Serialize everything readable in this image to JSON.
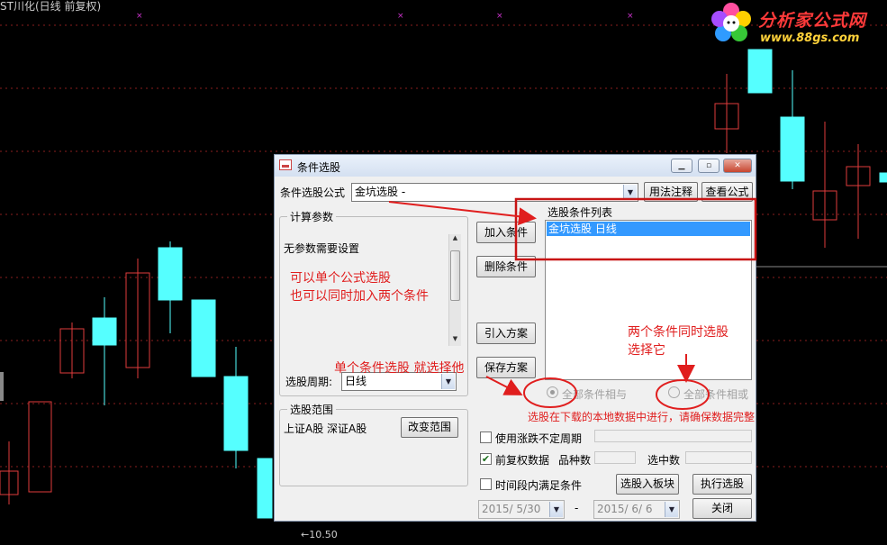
{
  "chart": {
    "stock_title": "ST川化(日线 前复权)",
    "price_marker": "←10.50"
  },
  "logo": {
    "name": "分析家公式网",
    "url": "www.88gs.com",
    "icon": "flower-logo-icon"
  },
  "dialog": {
    "title": "条件选股",
    "formula_label": "条件选股公式",
    "formula_value": "金坑选股        -",
    "usage_button": "用法注释",
    "view_formula_button": "查看公式",
    "params_group_title": "计算参数",
    "params_text": "无参数需要设置",
    "add_condition_button": "加入条件",
    "delete_condition_button": "删除条件",
    "import_plan_button": "引入方案",
    "save_plan_button": "保存方案",
    "condition_list_title": "选股条件列表",
    "condition_list_items": [
      "金坑选股   日线"
    ],
    "period_label": "选股周期:",
    "period_value": "日线",
    "all_and_label": "全部条件相与",
    "all_or_label": "全部条件相或",
    "scope_group_title": "选股范围",
    "scope_text": "上证A股 深证A股",
    "change_scope_button": "改变范围",
    "use_variable_period_label": "使用涨跌不定周期",
    "forward_adjust_label": "前复权数据",
    "forward_adjust_checked": true,
    "variety_count_label": "品种数",
    "selected_count_label": "选中数",
    "time_range_label": "时间段内满足条件",
    "add_to_block_button": "选股入板块",
    "execute_button": "执行选股",
    "close_button": "关闭",
    "date_from": "2015/ 5/30",
    "date_sep": "-",
    "date_to": "2015/ 6/ 6"
  },
  "annotations": {
    "note_single_formula": "可以单个公式选股",
    "note_two_conditions": "也可以同时加入两个条件",
    "note_two_select": "两个条件同时选股",
    "note_choose_it": "选择它",
    "note_single_select": "单个条件选股 就选择他",
    "note_download": "选股在下载的本地数据中进行，请确保数据完整"
  },
  "colors": {
    "up_candle": "#e03c3c",
    "down_candle": "#55ffff",
    "annotation": "#e01e1e",
    "list_selection": "#3399ff"
  }
}
